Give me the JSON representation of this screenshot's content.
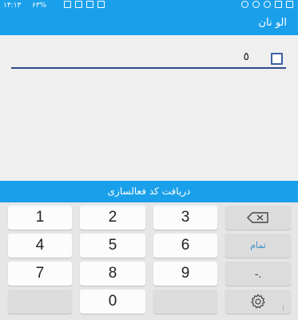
{
  "status_bar": {
    "time": "۱۴:۱۳",
    "battery": "۶۳%",
    "left_icons": [
      "notes-icon",
      "mail-icon",
      "usb-icon",
      "image-icon"
    ],
    "right_icons": [
      "wifi-icon",
      "alarm-icon",
      "eye-icon",
      "image-icon",
      "mail-icon"
    ]
  },
  "app_bar": {
    "title": "الو نان"
  },
  "input": {
    "value": "٥",
    "checkbox_checked": false
  },
  "activate_button": {
    "label": "دریافت کد فعالسازی"
  },
  "keypad": {
    "keys": {
      "k1": "1",
      "k2": "2",
      "k3": "3",
      "k4": "4",
      "k5": "5",
      "k6": "6",
      "k7": "7",
      "k8": "8",
      "k9": "9",
      "k0": "0"
    },
    "done_label": "تمام",
    "symbol_label": "-."
  },
  "colors": {
    "accent": "#1aa0ea",
    "underline": "#2f4a8a"
  }
}
